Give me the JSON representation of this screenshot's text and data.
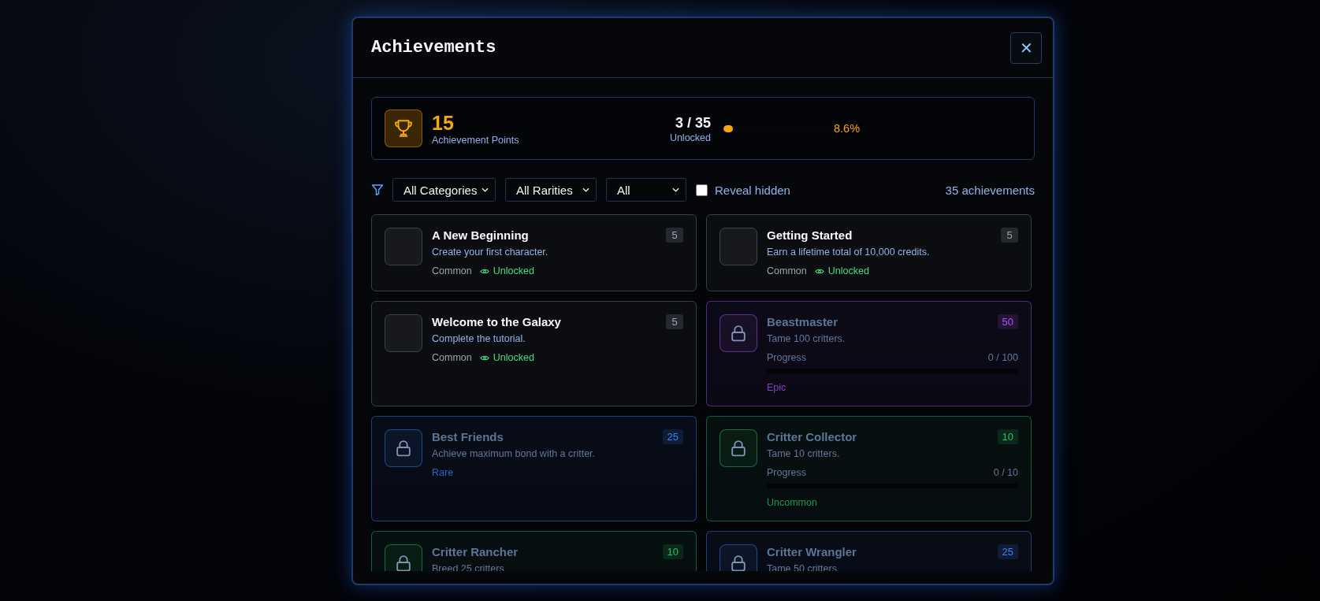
{
  "dialog": {
    "title": "Achievements",
    "close_label": "✕"
  },
  "summary": {
    "points": "15",
    "points_label": "Achievement Points",
    "unlocked": "3 / 35",
    "unlocked_label": "Unlocked",
    "level": 0.086,
    "percent": "8.6%"
  },
  "filters": {
    "category": "All Categories",
    "rarity": "All Rarities",
    "status": "All",
    "reveal_hidden": {
      "label": "Reveal hidden",
      "checked": false
    },
    "count": "35 achievements"
  },
  "achievements": [
    {
      "title": "A New Beginning",
      "description": "Create your first character.",
      "points": "5",
      "rarity": "Common",
      "color": "#9ca3af",
      "kind": "unlocked",
      "status": "Unlocked"
    },
    {
      "title": "Getting Started",
      "description": "Earn a lifetime total of 10,000 credits.",
      "points": "5",
      "rarity": "Common",
      "color": "#9ca3af",
      "kind": "unlocked",
      "status": "Unlocked"
    },
    {
      "title": "Welcome to the Galaxy",
      "description": "Complete the tutorial.",
      "points": "5",
      "rarity": "Common",
      "color": "#9ca3af",
      "kind": "unlocked",
      "status": "Unlocked"
    },
    {
      "title": "Beastmaster",
      "description": "Tame 100 critters.",
      "points": "50",
      "rarity": "Epic",
      "color": "#a855f7",
      "kind": "locked",
      "progress_label": "Progress",
      "progress": "0 / 100",
      "level": 0
    },
    {
      "title": "Best Friends",
      "description": "Achieve maximum bond with a critter.",
      "points": "25",
      "rarity": "Rare",
      "color": "#3b82f6",
      "kind": "locked"
    },
    {
      "title": "Critter Collector",
      "description": "Tame 10 critters.",
      "points": "10",
      "rarity": "Uncommon",
      "color": "#22c55e",
      "kind": "locked",
      "progress_label": "Progress",
      "progress": "0 / 10",
      "level": 0
    },
    {
      "title": "Critter Rancher",
      "description": "Breed 25 critters",
      "points": "10",
      "color": "#22c55e",
      "kind": "locked"
    },
    {
      "title": "Critter Wrangler",
      "description": "Tame 50 critters",
      "points": "25",
      "color": "#3b82f6",
      "kind": "locked"
    }
  ]
}
